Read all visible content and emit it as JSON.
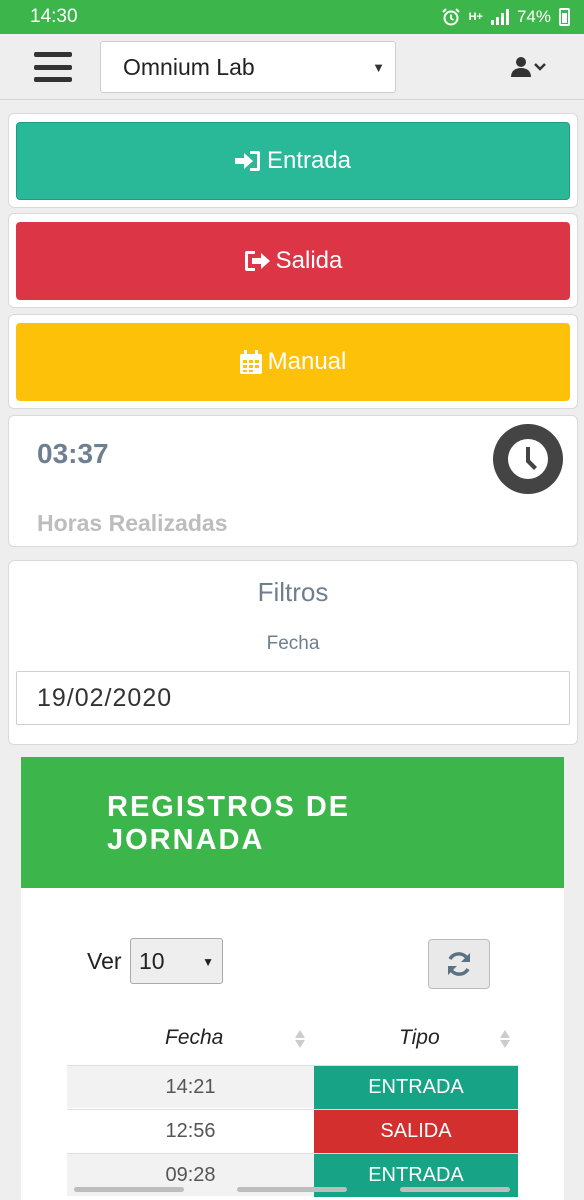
{
  "status_bar": {
    "time": "14:30",
    "network": "H+",
    "battery": "74%"
  },
  "header": {
    "lab_selected": "Omnium Lab"
  },
  "actions": {
    "entrada": "Entrada",
    "salida": "Salida",
    "manual": "Manual"
  },
  "hours": {
    "value": "03:37",
    "label": "Horas Realizadas"
  },
  "filters": {
    "title": "Filtros",
    "date_label": "Fecha",
    "date_value": "19/02/2020"
  },
  "registros": {
    "title_line1": "REGISTROS DE",
    "title_line2": "JORNADA",
    "ver_label": "Ver",
    "ver_value": "10",
    "columns": [
      "Fecha",
      "Tipo"
    ],
    "rows": [
      {
        "fecha": "14:21",
        "tipo": "ENTRADA"
      },
      {
        "fecha": "12:56",
        "tipo": "SALIDA"
      },
      {
        "fecha": "09:28",
        "tipo": "ENTRADA"
      }
    ]
  },
  "colors": {
    "brand_green": "#3cb54a",
    "entrada": "#2ab998",
    "salida": "#dc3545",
    "manual": "#fdc10a"
  }
}
